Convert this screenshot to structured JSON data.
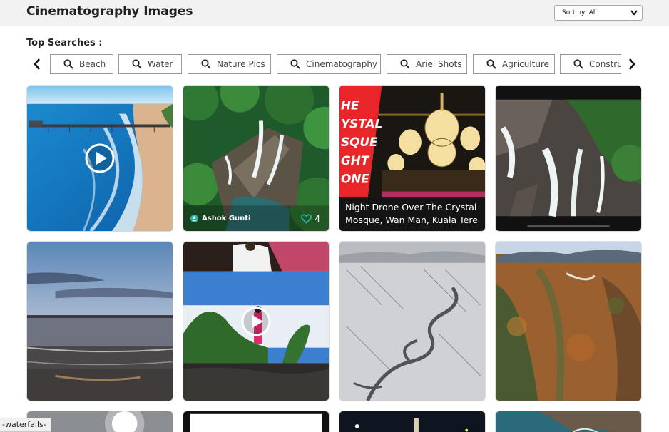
{
  "header": {
    "title": "Cinematography Images",
    "sort_label": "Sort by: All"
  },
  "top_searches": {
    "label": "Top Searches :",
    "chips": [
      "Beach",
      "Water",
      "Nature Pics",
      "Cinematography",
      "Ariel Shots",
      "Agriculture",
      "Construction"
    ]
  },
  "cards": {
    "c2": {
      "author": "Ashok Gunti",
      "likes": "4"
    },
    "c3": {
      "caption_line1": "Night Drone Over The Crystal",
      "caption_line2": "Mosque, Wan Man, Kuala Tere",
      "poster_text": "THE CRYSTAL MOSQUE NIGHT DRONE"
    }
  },
  "status_bar": {
    "text": "-waterfalls-"
  },
  "colors": {
    "accent": "#2bb5a8",
    "poster_red": "#e8262a"
  },
  "icons": [
    "search-icon",
    "chevron-left-icon",
    "chevron-right-icon",
    "chevron-down-icon",
    "play-icon",
    "heart-icon",
    "user-icon"
  ]
}
